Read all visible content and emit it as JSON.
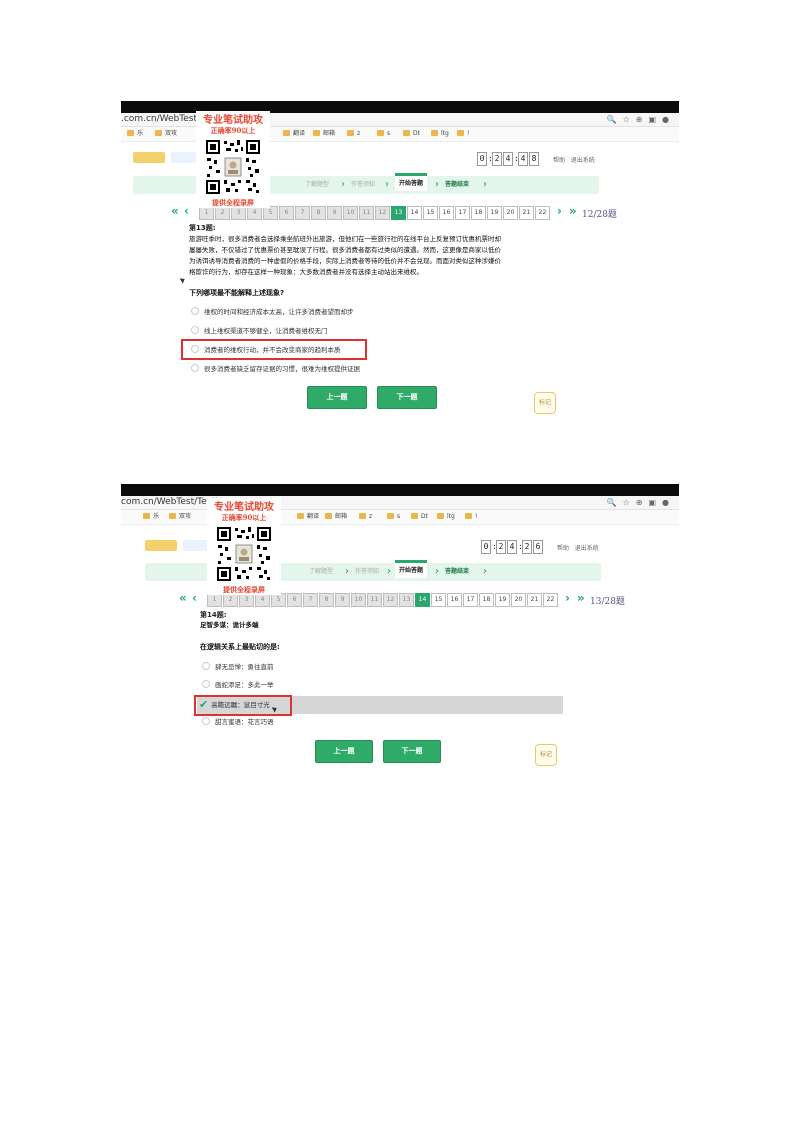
{
  "overlay": {
    "title": "专业笔试助攻",
    "accuracy": "正确率90以上",
    "footer": "提供全程录屏"
  },
  "screen1": {
    "url": ".com.cn/WebTest/TestIn",
    "bookmarks": [
      "乐",
      "双攻",
      "翻译",
      "邮箱",
      "z",
      "s",
      "Dt",
      "ltg",
      "!"
    ],
    "timer": [
      "0",
      "2",
      "4",
      "4",
      "8"
    ],
    "top_links": [
      "帮助",
      "退出系统"
    ],
    "steps": [
      "了解题型",
      "作答须知",
      "开始答题",
      "答题结束"
    ],
    "active_step": 2,
    "numbers": [
      "1",
      "2",
      "3",
      "4",
      "5",
      "6",
      "7",
      "8",
      "9",
      "10",
      "11",
      "12",
      "13",
      "14",
      "15",
      "16",
      "17",
      "18",
      "19",
      "20",
      "21",
      "22"
    ],
    "current_index": 12,
    "counter": "12/28题",
    "q_title": "第13题:",
    "q_text": [
      "旅游旺季时，很多消费者会选择乘坐航班外出旅游，但他们在一些旅行社的在线平台上反复预订优惠机票时却",
      "屡屡失败，不仅错过了优惠票价甚至耽误了行程。很多消费者都有过类似的遭遇。然而，这更像是商家以低价",
      "为诱饵诱导消费者消费的一种虚假的价格手段，实际上消费者等待的低价并不会兑现。而面对类似这种涉嫌价",
      "格欺诈的行为，却存在这样一种现象：大多数消费者并没有选择主动站出来维权。"
    ],
    "q_prompt": "下列哪项最不能解释上述现象?",
    "options": [
      "维权的时间和经济成本太高，让许多消费者望而却步",
      "线上维权渠道不够健全，让消费者维权无门",
      "消费者的维权行动，并不会改变商家的趋利本质",
      "很多消费者缺乏留存证据的习惯，很难为维权提供证据"
    ],
    "prev_label": "上一题",
    "next_label": "下一题",
    "mark_label": "标记"
  },
  "screen2": {
    "url": "com.cn/WebTest/TestIn",
    "bookmarks": [
      "乐",
      "双攻",
      "翻译",
      "邮箱",
      "z",
      "s",
      "Dt",
      "ltg",
      "!"
    ],
    "timer": [
      "0",
      "2",
      "4",
      "2",
      "6"
    ],
    "top_links": [
      "帮助",
      "退出系统"
    ],
    "steps": [
      "了解题型",
      "作答须知",
      "开始答题",
      "答题结束"
    ],
    "active_step": 2,
    "numbers": [
      "1",
      "2",
      "3",
      "4",
      "5",
      "6",
      "7",
      "8",
      "9",
      "10",
      "11",
      "12",
      "13",
      "14",
      "15",
      "16",
      "17",
      "18",
      "19",
      "20",
      "21",
      "22"
    ],
    "current_index": 13,
    "counter": "13/28题",
    "q_title": "第14题:",
    "q_text": [
      "足智多谋：诡计多端"
    ],
    "q_prompt": "在逻辑关系上最贴切的是:",
    "options": [
      "肆无忌惮：勇往直前",
      "画蛇添足：多此一举",
      "高瞻远瞩：鼠目寸光",
      "甜言蜜语：花言巧语"
    ],
    "selected_option": 2,
    "prev_label": "上一题",
    "next_label": "下一题",
    "mark_label": "标记"
  }
}
